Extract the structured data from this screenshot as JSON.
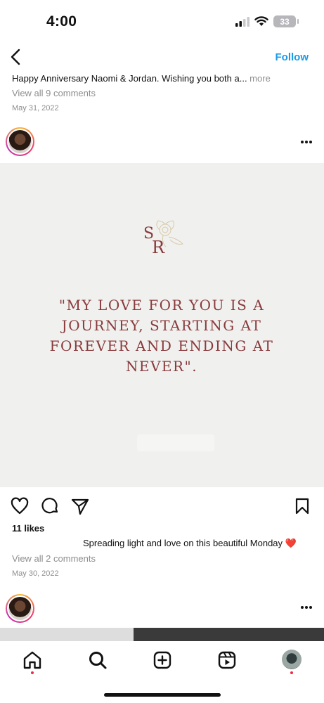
{
  "status_bar": {
    "time": "4:00",
    "battery": "33"
  },
  "nav": {
    "follow_label": "Follow"
  },
  "post1": {
    "caption": "Happy Anniversary Naomi & Jordan. Wishing you both a...",
    "more_label": " more",
    "view_comments": "View all 9 comments",
    "date": "May 31, 2022"
  },
  "post2": {
    "monogram": "SR",
    "quote": "\"MY LOVE FOR YOU IS A JOURNEY, STARTING AT FOREVER AND ENDING AT NEVER\".",
    "likes": "11 likes",
    "caption": "Spreading light and love on this beautiful Monday ❤️",
    "view_comments": "View all 2 comments",
    "date": "May 30, 2022"
  },
  "bottom_nav": {
    "items": [
      "home-icon",
      "search-icon",
      "create-icon",
      "reels-icon",
      "profile-avatar"
    ]
  }
}
